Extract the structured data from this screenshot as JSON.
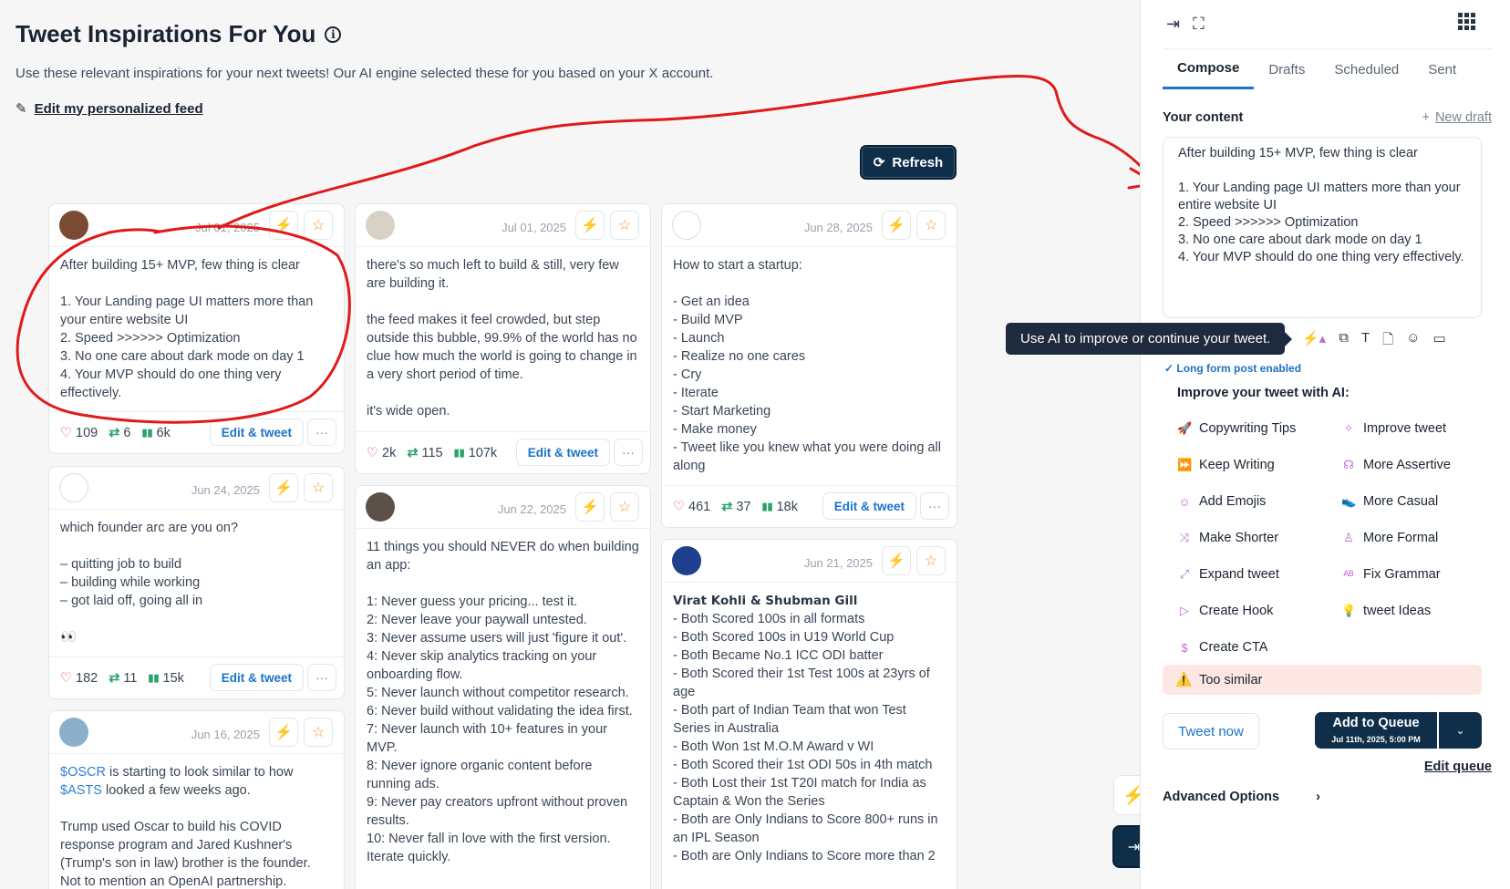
{
  "header": {
    "title": "Tweet Inspirations For You",
    "subtitle": "Use these relevant inspirations for your next tweets! Our AI engine selected these for you based on your X account.",
    "edit_feed": "Edit my personalized feed",
    "refresh": "Refresh"
  },
  "edit_tweet_label": "Edit & tweet",
  "more_label": "···",
  "cards": [
    {
      "date": "Jul 01, 2025",
      "body": "After building 15+ MVP, few thing is clear\n\n1. Your Landing page UI matters more than your entire website UI\n2. Speed >>>>>> Optimization\n3. No one care about dark mode on day 1\n4. Your MVP should do one thing very effectively.",
      "likes": "109",
      "retweets": "6",
      "views": "6k"
    },
    {
      "date": "Jun 24, 2025",
      "body": "which founder arc are you on?\n\n– quitting job to build\n– building while working\n– got laid off, going all in\n\n👀",
      "likes": "182",
      "retweets": "11",
      "views": "15k"
    },
    {
      "date": "Jun 16, 2025",
      "body_link1": "$OSCR",
      "body_mid": " is starting to look similar to how ",
      "body_link2": "$ASTS",
      "body_rest": " looked a few weeks ago.\n\nTrump used Oscar to build his COVID response program and Jared Kushner's (Trump's son in law) brother is the founder. Not to mention an OpenAI partnership."
    },
    {
      "date": "Jul 01, 2025",
      "body": "there's so much left to build & still, very few are building it.\n\nthe feed makes it feel crowded, but step outside this bubble, 99.9% of the world has no clue how much the world is going to change in a very short period of time.\n\nit's wide open.",
      "likes": "2k",
      "retweets": "115",
      "views": "107k"
    },
    {
      "date": "Jun 22, 2025",
      "body": "11 things you should NEVER do when building an app:\n\n1: Never guess your pricing... test it.\n2: Never leave your paywall untested.\n3: Never assume users will just 'figure it out'.\n4: Never skip analytics tracking on your onboarding flow.\n5: Never launch without competitor research.\n6: Never build without validating the idea first.\n7: Never launch with 10+ features in your MVP.\n8: Never ignore organic content before running ads.\n9: Never pay creators upfront without proven results.\n10: Never fall in love with the first version. Iterate quickly."
    },
    {
      "date": "Jun 28, 2025",
      "body": "How to start a startup:\n\n- Get an idea\n- Build MVP\n- Launch\n- Realize no one cares\n- Cry\n- Iterate\n- Start Marketing\n- Make money\n- Tweet like you knew what you were doing all along",
      "likes": "461",
      "retweets": "37",
      "views": "18k"
    },
    {
      "date": "Jun 21, 2025",
      "body_bold": "Virat Kohli & Shubman Gill",
      "body": "\n- Both Scored 100s in all formats\n- Both Scored 100s in U19 World Cup\n- Both Became No.1 ICC ODI batter\n- Both Scored their 1st Test 100s at 23yrs of age\n- Both part of Indian Team that won Test Series in Australia\n- Both Won 1st M.O.M Award v WI\n- Both Scored their 1st ODI 50s in 4th match\n- Both Lost their 1st T20I match for India as Captain & Won the Series\n- Both are Only Indians to Score 800+ runs in an IPL Season\n- Both are Only Indians to Score more than 2"
    }
  ],
  "sidebar": {
    "tabs": [
      "Compose",
      "Drafts",
      "Scheduled",
      "Sent"
    ],
    "your_content": "Your content",
    "new_draft": "New draft",
    "editor_text": "After building 15+ MVP, few thing is clear\n\n1. Your Landing page UI matters more than your entire website UI\n2. Speed >>>>>> Optimization\n3. No one care about dark mode on day 1\n4. Your MVP should do one thing very effectively.",
    "tooltip": "Use AI to improve or continue your tweet.",
    "long_form": "Long form post enabled",
    "improve_heading": "Improve your tweet with AI:",
    "options": [
      {
        "label": "Copywriting Tips",
        "icon": "rocket-icon"
      },
      {
        "label": "Improve tweet",
        "icon": "wand-icon"
      },
      {
        "label": "Keep Writing",
        "icon": "fast-forward-icon"
      },
      {
        "label": "More Assertive",
        "icon": "megaphone-icon"
      },
      {
        "label": "Add Emojis",
        "icon": "smiley-icon"
      },
      {
        "label": "More Casual",
        "icon": "sneaker-icon"
      },
      {
        "label": "Make Shorter",
        "icon": "shrink-icon"
      },
      {
        "label": "More Formal",
        "icon": "person-icon"
      },
      {
        "label": "Expand tweet",
        "icon": "expand-icon"
      },
      {
        "label": "Fix Grammar",
        "icon": "spellcheck-icon"
      },
      {
        "label": "Create Hook",
        "icon": "play-icon"
      },
      {
        "label": "tweet Ideas",
        "icon": "bulb-icon"
      },
      {
        "label": "Create CTA",
        "icon": "dollar-icon"
      }
    ],
    "too_similar": "Too similar",
    "tweet_now": "Tweet now",
    "add_to_queue": "Add to Queue",
    "queue_time": "Jul 11th, 2025, 5:00 PM",
    "edit_queue": "Edit queue",
    "advanced": "Advanced Options"
  }
}
